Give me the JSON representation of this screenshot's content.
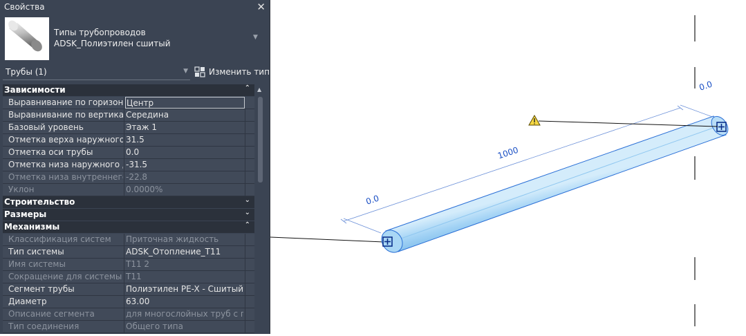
{
  "panel": {
    "title": "Свойства",
    "close_glyph": "✕",
    "type_selector": {
      "family": "Типы трубопроводов",
      "type": "ADSK_Полиэтилен сшитый",
      "thumbnail_icon": "pipe-thumbnail-icon"
    },
    "filter": {
      "label": "Трубы (1)"
    },
    "edit_type": {
      "label": "Изменить тип",
      "icon": "edit-type-icon"
    }
  },
  "sections": {
    "constraints": {
      "title": "Зависимости",
      "expanded": true,
      "rows": [
        {
          "name": "Выравнивание по горизонта...",
          "value": "Центр"
        },
        {
          "name": "Выравнивание по вертикали",
          "value": "Середина"
        },
        {
          "name": "Базовый уровень",
          "value": "Этаж 1"
        },
        {
          "name": "Отметка верха наружного д...",
          "value": "31.5"
        },
        {
          "name": "Отметка оси трубы",
          "value": "0.0"
        },
        {
          "name": "Отметка низа наружного ди...",
          "value": "-31.5"
        },
        {
          "name": "Отметка низа внутреннего д...",
          "value": "-22.8"
        },
        {
          "name": "Уклон",
          "value": "0.0000%"
        }
      ]
    },
    "construction": {
      "title": "Строительство",
      "expanded": false
    },
    "dimensions": {
      "title": "Размеры",
      "expanded": false
    },
    "mechanical": {
      "title": "Механизмы",
      "expanded": true,
      "rows": [
        {
          "name": "Классификация систем",
          "value": "Приточная жидкость"
        },
        {
          "name": "Тип системы",
          "value": "ADSK_Отопление_Т11"
        },
        {
          "name": "Имя системы",
          "value": "Т11 2"
        },
        {
          "name": "Сокращение для системы",
          "value": "Т11"
        },
        {
          "name": "Сегмент трубы",
          "value": "Полиэтилен PE-X - Сшитый ..."
        },
        {
          "name": "Диаметр",
          "value": "63.00"
        },
        {
          "name": "Описание сегмента",
          "value": "для многослойных труб с пр..."
        },
        {
          "name": "Тип соединения",
          "value": "Общего типа"
        }
      ]
    }
  },
  "viewport": {
    "length_label": "1000",
    "offset_label_left": "0.0",
    "offset_label_top": "0.0",
    "pipe_color": "#a9d7f5",
    "pipe_edge_color": "#2a6fd6",
    "warning_icon": "warning-icon",
    "connector_icon": "pipe-connector-icon"
  }
}
